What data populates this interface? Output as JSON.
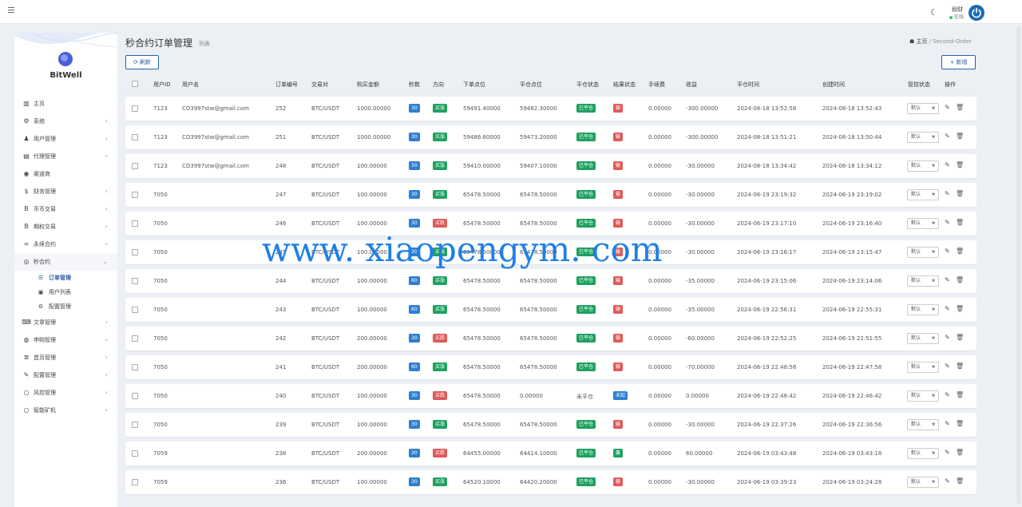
{
  "topbar": {
    "user_name": "段财",
    "user_status": "在线"
  },
  "sidebar": {
    "logo": "BitWell",
    "items": [
      {
        "label": "主页",
        "icon": "bar-chart-icon",
        "glyph": "▥",
        "expandable": false
      },
      {
        "label": "系统",
        "icon": "gear-icon",
        "glyph": "⚙",
        "expandable": true
      },
      {
        "label": "用户管理",
        "icon": "users-icon",
        "glyph": "♟",
        "expandable": true
      },
      {
        "label": "代理管理",
        "icon": "id-card-icon",
        "glyph": "▤",
        "expandable": true
      },
      {
        "label": "渠道商",
        "icon": "user-circle-icon",
        "glyph": "◉",
        "expandable": false
      },
      {
        "label": "财务管理",
        "icon": "dollar-icon",
        "glyph": "$",
        "expandable": true
      },
      {
        "label": "币币交易",
        "icon": "bitcoin-icon",
        "glyph": "B",
        "expandable": true
      },
      {
        "label": "期权交易",
        "icon": "bitcoin-icon",
        "glyph": "B",
        "expandable": true
      },
      {
        "label": "永续合约",
        "icon": "link-icon",
        "glyph": "∞",
        "expandable": true
      },
      {
        "label": "秒合约",
        "icon": "target-icon",
        "glyph": "◎",
        "expandable": true,
        "open": true,
        "children": [
          {
            "label": "订单管理",
            "icon": "list-icon",
            "glyph": "☰",
            "active": true
          },
          {
            "label": "用户列表",
            "icon": "user-box-icon",
            "glyph": "▣",
            "active": false
          },
          {
            "label": "配置管理",
            "icon": "gear-icon",
            "glyph": "⚙",
            "active": false
          }
        ]
      },
      {
        "label": "文章管理",
        "icon": "keyboard-icon",
        "glyph": "⌨",
        "expandable": true
      },
      {
        "label": "申购管理",
        "icon": "lifebuoy-icon",
        "glyph": "◍",
        "expandable": true
      },
      {
        "label": "首页管理",
        "icon": "server-icon",
        "glyph": "≣",
        "expandable": true
      },
      {
        "label": "配置管理",
        "icon": "wrench-icon",
        "glyph": "✎",
        "expandable": true
      },
      {
        "label": "风控管理",
        "icon": "circle-icon",
        "glyph": "○",
        "expandable": true
      },
      {
        "label": "智能矿机",
        "icon": "circle-icon",
        "glyph": "○",
        "expandable": true
      }
    ]
  },
  "header": {
    "title": "秒合约订单管理",
    "subtitle": "列表",
    "breadcrumb_home": "主页",
    "breadcrumb_sep": "/",
    "breadcrumb_current": "Second-Order"
  },
  "toolbar": {
    "refresh_label": "刷新",
    "add_label": "+ 新增"
  },
  "table": {
    "columns": [
      "用户ID",
      "用户名",
      "订单编号",
      "交易对",
      "购买金额",
      "秒数",
      "方向",
      "下单点位",
      "平仓点位",
      "平仓状态",
      "结果状态",
      "手续费",
      "收益",
      "平仓时间",
      "创建时间",
      "管控状态",
      "操作"
    ],
    "control_default": "默认",
    "rows": [
      {
        "uid": "7123",
        "username": "CO3997stw@gmail.com",
        "order_no": "252",
        "pair": "BTC/USDT",
        "amount": "1000.00000",
        "seconds": "30",
        "direction": "买涨",
        "dir_type": "up",
        "open_price": "59491.40000",
        "close_price": "59482.30000",
        "close_status": "已平仓",
        "closed": true,
        "result": "输",
        "result_type": "lose",
        "fee": "0.00000",
        "profit": "-300.00000",
        "close_time": "2024-08-18 13:52:58",
        "create_time": "2024-08-18 13:52:43"
      },
      {
        "uid": "7123",
        "username": "CO3997stw@gmail.com",
        "order_no": "251",
        "pair": "BTC/USDT",
        "amount": "1000.00000",
        "seconds": "30",
        "direction": "买涨",
        "dir_type": "up",
        "open_price": "59486.80000",
        "close_price": "59473.20000",
        "close_status": "已平仓",
        "closed": true,
        "result": "输",
        "result_type": "lose",
        "fee": "0.00000",
        "profit": "-300.00000",
        "close_time": "2024-08-18 13:51:21",
        "create_time": "2024-08-18 13:50:44"
      },
      {
        "uid": "7123",
        "username": "CO3997stw@gmail.com",
        "order_no": "248",
        "pair": "BTC/USDT",
        "amount": "100.00000",
        "seconds": "30",
        "direction": "买涨",
        "dir_type": "up",
        "open_price": "59410.00000",
        "close_price": "59407.10000",
        "close_status": "已平仓",
        "closed": true,
        "result": "输",
        "result_type": "lose",
        "fee": "0.00000",
        "profit": "-30.00000",
        "close_time": "2024-08-18 13:34:42",
        "create_time": "2024-08-18 13:34:12"
      },
      {
        "uid": "7050",
        "username": "",
        "order_no": "247",
        "pair": "BTC/USDT",
        "amount": "100.00000",
        "seconds": "30",
        "direction": "买涨",
        "dir_type": "up",
        "open_price": "65478.50000",
        "close_price": "65478.50000",
        "close_status": "已平仓",
        "closed": true,
        "result": "输",
        "result_type": "lose",
        "fee": "0.00000",
        "profit": "-30.00000",
        "close_time": "2024-06-19 23:19:32",
        "create_time": "2024-06-19 23:19:02"
      },
      {
        "uid": "7050",
        "username": "",
        "order_no": "246",
        "pair": "BTC/USDT",
        "amount": "100.00000",
        "seconds": "30",
        "direction": "买跌",
        "dir_type": "down",
        "open_price": "65478.50000",
        "close_price": "65478.50000",
        "close_status": "已平仓",
        "closed": true,
        "result": "输",
        "result_type": "lose",
        "fee": "0.00000",
        "profit": "-30.00000",
        "close_time": "2024-06-19 23:17:10",
        "create_time": "2024-06-19 23:16:40"
      },
      {
        "uid": "7050",
        "username": "",
        "order_no": "245",
        "pair": "BTC/USDT",
        "amount": "100.00000",
        "seconds": "30",
        "direction": "买涨",
        "dir_type": "up",
        "open_price": "65478.50000",
        "close_price": "65478.50000",
        "close_status": "已平仓",
        "closed": true,
        "result": "输",
        "result_type": "lose",
        "fee": "0.00000",
        "profit": "-30.00000",
        "close_time": "2024-06-19 23:16:17",
        "create_time": "2024-06-19 23:15:47"
      },
      {
        "uid": "7050",
        "username": "",
        "order_no": "244",
        "pair": "BTC/USDT",
        "amount": "100.00000",
        "seconds": "60",
        "direction": "买涨",
        "dir_type": "up",
        "open_price": "65478.50000",
        "close_price": "65478.50000",
        "close_status": "已平仓",
        "closed": true,
        "result": "输",
        "result_type": "lose",
        "fee": "0.00000",
        "profit": "-35.00000",
        "close_time": "2024-06-19 23:15:06",
        "create_time": "2024-06-19 23:14:06"
      },
      {
        "uid": "7050",
        "username": "",
        "order_no": "243",
        "pair": "BTC/USDT",
        "amount": "100.00000",
        "seconds": "60",
        "direction": "买涨",
        "dir_type": "up",
        "open_price": "65478.50000",
        "close_price": "65478.50000",
        "close_status": "已平仓",
        "closed": true,
        "result": "输",
        "result_type": "lose",
        "fee": "0.00000",
        "profit": "-35.00000",
        "close_time": "2024-06-19 22:56:31",
        "create_time": "2024-06-19 22:55:31"
      },
      {
        "uid": "7050",
        "username": "",
        "order_no": "242",
        "pair": "BTC/USDT",
        "amount": "200.00000",
        "seconds": "30",
        "direction": "买跌",
        "dir_type": "down",
        "open_price": "65478.50000",
        "close_price": "65478.50000",
        "close_status": "已平仓",
        "closed": true,
        "result": "输",
        "result_type": "lose",
        "fee": "0.00000",
        "profit": "-60.00000",
        "close_time": "2024-06-19 22:52:25",
        "create_time": "2024-06-19 22:51:55"
      },
      {
        "uid": "7050",
        "username": "",
        "order_no": "241",
        "pair": "BTC/USDT",
        "amount": "200.00000",
        "seconds": "60",
        "direction": "买涨",
        "dir_type": "up",
        "open_price": "65478.50000",
        "close_price": "65478.50000",
        "close_status": "已平仓",
        "closed": true,
        "result": "输",
        "result_type": "lose",
        "fee": "0.00000",
        "profit": "-70.00000",
        "close_time": "2024-06-19 22:48:58",
        "create_time": "2024-06-19 22:47:58"
      },
      {
        "uid": "7050",
        "username": "",
        "order_no": "240",
        "pair": "BTC/USDT",
        "amount": "100.00000",
        "seconds": "30",
        "direction": "买跌",
        "dir_type": "down",
        "open_price": "65478.50000",
        "close_price": "0.00000",
        "close_status": "未平仓",
        "closed": false,
        "result": "未知",
        "result_type": "unknown",
        "fee": "0.00000",
        "profit": "0.00000",
        "close_time": "2024-06-19 22:46:42",
        "create_time": "2024-06-19 22:46:42"
      },
      {
        "uid": "7050",
        "username": "",
        "order_no": "239",
        "pair": "BTC/USDT",
        "amount": "100.00000",
        "seconds": "30",
        "direction": "买涨",
        "dir_type": "up",
        "open_price": "65478.50000",
        "close_price": "65478.50000",
        "close_status": "已平仓",
        "closed": true,
        "result": "输",
        "result_type": "lose",
        "fee": "0.00000",
        "profit": "-30.00000",
        "close_time": "2024-06-19 22:37:26",
        "create_time": "2024-06-19 22:36:56"
      },
      {
        "uid": "7059",
        "username": "",
        "order_no": "238",
        "pair": "BTC/USDT",
        "amount": "200.00000",
        "seconds": "30",
        "direction": "买跌",
        "dir_type": "down",
        "open_price": "64455.00000",
        "close_price": "64414.10000",
        "close_status": "已平仓",
        "closed": true,
        "result": "赢",
        "result_type": "win",
        "fee": "0.00000",
        "profit": "60.00000",
        "close_time": "2024-06-19 03:43:48",
        "create_time": "2024-06-19 03:43:18"
      },
      {
        "uid": "7059",
        "username": "",
        "order_no": "236",
        "pair": "BTC/USDT",
        "amount": "100.00000",
        "seconds": "30",
        "direction": "买涨",
        "dir_type": "up",
        "open_price": "64520.10000",
        "close_price": "64420.20000",
        "close_status": "已平仓",
        "closed": true,
        "result": "输",
        "result_type": "lose",
        "fee": "0.00000",
        "profit": "-30.00000",
        "close_time": "2024-06-19 03:39:23",
        "create_time": "2024-06-19 03:24:28"
      }
    ]
  },
  "watermark": "www. xiaopengym. com",
  "colors": {
    "accent": "#2b5ba9",
    "up": "#1ea160",
    "down": "#e05a5a",
    "seconds": "#2f7fd0",
    "watermark": "#1f7fe8"
  }
}
